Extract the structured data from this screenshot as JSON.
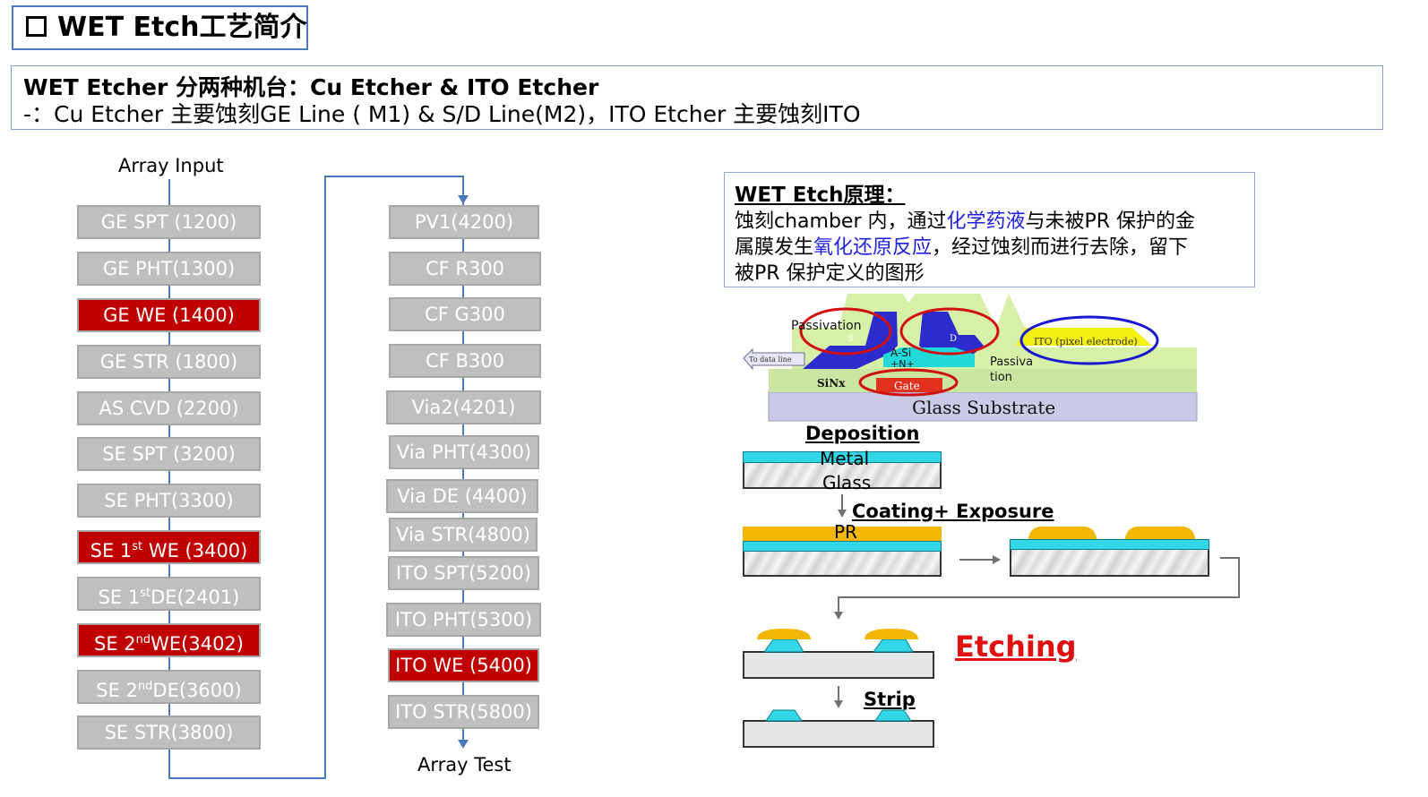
{
  "title": "WET Etch工艺简介",
  "intro": {
    "title": "WET Etcher 分两种机台：Cu Etcher & ITO Etcher",
    "detail": "-：Cu Etcher 主要蚀刻GE Line ( M1) & S/D Line(M2)，ITO Etcher 主要蚀刻ITO"
  },
  "flow": {
    "start_label": "Array Input",
    "end_label": "Array Test",
    "column1": [
      {
        "label": "GE SPT (1200)",
        "highlight": false
      },
      {
        "label": "GE PHT(1300)",
        "highlight": false
      },
      {
        "label": "GE WE (1400)",
        "highlight": true
      },
      {
        "label": "GE STR (1800)",
        "highlight": false
      },
      {
        "label": "AS CVD (2200)",
        "highlight": false
      },
      {
        "label": "SE SPT (3200)",
        "highlight": false
      },
      {
        "label": "SE PHT(3300)",
        "highlight": false
      },
      {
        "label": "SE 1st WE (3400)",
        "highlight": true
      },
      {
        "label": "SE 1stDE(2401)",
        "highlight": false
      },
      {
        "label": "SE 2ndWE(3402)",
        "highlight": true
      },
      {
        "label": "SE 2ndDE(3600)",
        "highlight": false
      },
      {
        "label": "SE STR(3800)",
        "highlight": false
      }
    ],
    "column2": [
      {
        "label": "PV1(4200)",
        "highlight": false
      },
      {
        "label": "CF R300",
        "highlight": false
      },
      {
        "label": "CF G300",
        "highlight": false
      },
      {
        "label": "CF B300",
        "highlight": false
      },
      {
        "label": "Via2(4201)",
        "highlight": false
      },
      {
        "label": "Via PHT(4300)",
        "highlight": false
      },
      {
        "label": "Via DE (4400)",
        "highlight": false
      },
      {
        "label": "Via STR(4800)",
        "highlight": false
      },
      {
        "label": "ITO SPT(5200)",
        "highlight": false
      },
      {
        "label": "ITO PHT(5300)",
        "highlight": false
      },
      {
        "label": "ITO WE (5400)",
        "highlight": true
      },
      {
        "label": "ITO STR(5800)",
        "highlight": false
      }
    ],
    "colors": {
      "normal": "#bfbfbf",
      "highlight": "#c00000",
      "connector": "#4a78b8"
    }
  },
  "principle": {
    "title": "WET Etch原理：",
    "line1_a": "蚀刻chamber 内，通过",
    "line1_b": "化学药液",
    "line1_c": "与未被PR 保护的金",
    "line2_a": "属膜发生",
    "line2_b": "氧化还原反应",
    "line2_c": "，经过蚀刻而进行去除，留下",
    "line3": "被PR 保护定义的图形"
  },
  "tft_diagram": {
    "passivation": "Passivation",
    "s": "S",
    "d": "D",
    "ito": "ITO (pixel electrode)",
    "data_line": "To data line",
    "asi": "A-Si",
    "n_plus": "+N+",
    "passivation2": "Passiva",
    "passivation3": "tion",
    "sinx": "SiNx",
    "gate": "Gate",
    "glass": "Glass Substrate"
  },
  "process": {
    "deposition": "Deposition",
    "metal": "Metal",
    "glass": "Glass",
    "coating": "Coating+ Exposure",
    "pr": "PR",
    "etching": "Etching",
    "strip": "Strip"
  }
}
